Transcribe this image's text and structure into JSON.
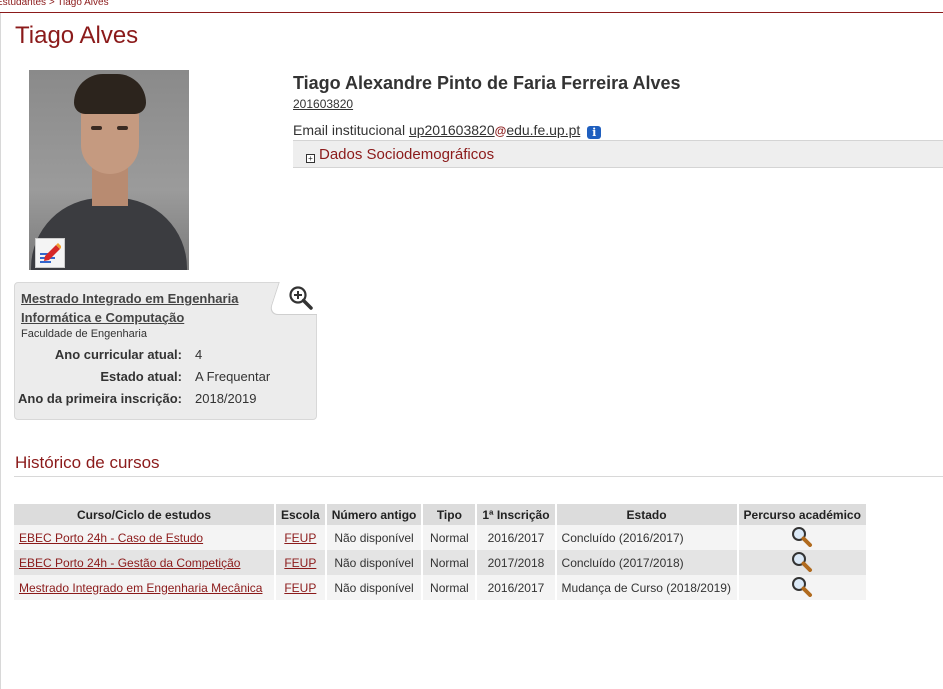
{
  "breadcrumb": "Estudantes > Tiago Alves",
  "page_title": "Tiago Alves",
  "profile": {
    "full_name": "Tiago Alexandre Pinto de Faria Ferreira Alves",
    "student_number": "201603820",
    "email_label": "Email institucional",
    "email_user": "up201603820",
    "email_at": "@",
    "email_domain": "edu.fe.up.pt",
    "email_info_icon": "i",
    "sociodemographic_label": "Dados Sociodemográficos",
    "sociodemographic_toggle": "+"
  },
  "icons": {
    "photo": "student-photo",
    "edit": "edit-photo-icon",
    "zoom": "zoom-in-icon",
    "info": "info-icon",
    "expand": "expand-plus-icon",
    "magnifier": "magnifier-icon"
  },
  "colors": {
    "accent": "#8b1a1a",
    "panel": "#ececec",
    "info_blue": "#1f5fbf"
  },
  "course_card": {
    "course_name": "Mestrado Integrado em Engenharia Informática e Computação",
    "faculty": "Faculdade de Engenharia",
    "rows": [
      {
        "label": "Ano curricular atual:",
        "value": "4"
      },
      {
        "label": "Estado atual:",
        "value": "A Frequentar"
      },
      {
        "label": "Ano da primeira inscrição:",
        "value": "2018/2019"
      }
    ]
  },
  "history": {
    "title": "Histórico de cursos",
    "columns": [
      "Curso/Ciclo de estudos",
      "Escola",
      "Número antigo",
      "Tipo",
      "1ª Inscrição",
      "Estado",
      "Percurso académico"
    ],
    "rows": [
      {
        "course": "EBEC Porto 24h - Caso de Estudo",
        "school": "FEUP",
        "old_number": "Não disponível",
        "type": "Normal",
        "first_enrollment": "2016/2017",
        "status": "Concluído (2016/2017)"
      },
      {
        "course": "EBEC Porto 24h - Gestão da Competição",
        "school": "FEUP",
        "old_number": "Não disponível",
        "type": "Normal",
        "first_enrollment": "2017/2018",
        "status": "Concluído (2017/2018)"
      },
      {
        "course": "Mestrado Integrado em Engenharia Mecânica",
        "school": "FEUP",
        "old_number": "Não disponível",
        "type": "Normal",
        "first_enrollment": "2016/2017",
        "status": "Mudança de Curso (2018/2019)"
      }
    ]
  }
}
